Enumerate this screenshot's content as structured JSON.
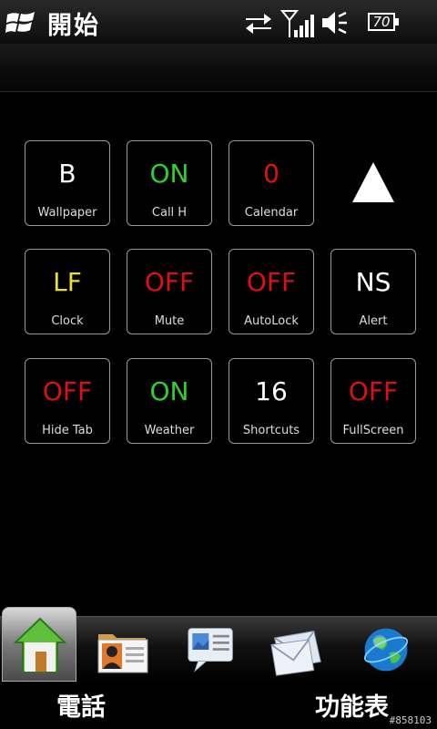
{
  "status": {
    "title": "開始",
    "battery": "70"
  },
  "tiles": [
    {
      "value": "B",
      "label": "Wallpaper",
      "color": "#ffffff"
    },
    {
      "value": "ON",
      "label": "Call H",
      "color": "#2ed12e"
    },
    {
      "value": "0",
      "label": "Calendar",
      "color": "#e01010"
    },
    {
      "value": "LF",
      "label": "Clock",
      "color": "#e8e030"
    },
    {
      "value": "OFF",
      "label": "Mute",
      "color": "#e01010"
    },
    {
      "value": "OFF",
      "label": "AutoLock",
      "color": "#e01010"
    },
    {
      "value": "NS",
      "label": "Alert",
      "color": "#ffffff"
    },
    {
      "value": "OFF",
      "label": "Hide Tab",
      "color": "#e01010"
    },
    {
      "value": "ON",
      "label": "Weather",
      "color": "#2ed12e"
    },
    {
      "value": "16",
      "label": "Shortcuts",
      "color": "#ffffff"
    },
    {
      "value": "OFF",
      "label": "FullScreen",
      "color": "#e01010"
    }
  ],
  "dock": {
    "items": [
      {
        "icon": "home-icon"
      },
      {
        "icon": "contact-card-icon"
      },
      {
        "icon": "message-icon"
      },
      {
        "icon": "mail-icon"
      },
      {
        "icon": "globe-icon"
      }
    ]
  },
  "softkeys": {
    "left": "電話",
    "right": "功能表"
  },
  "watermark": "#858103"
}
